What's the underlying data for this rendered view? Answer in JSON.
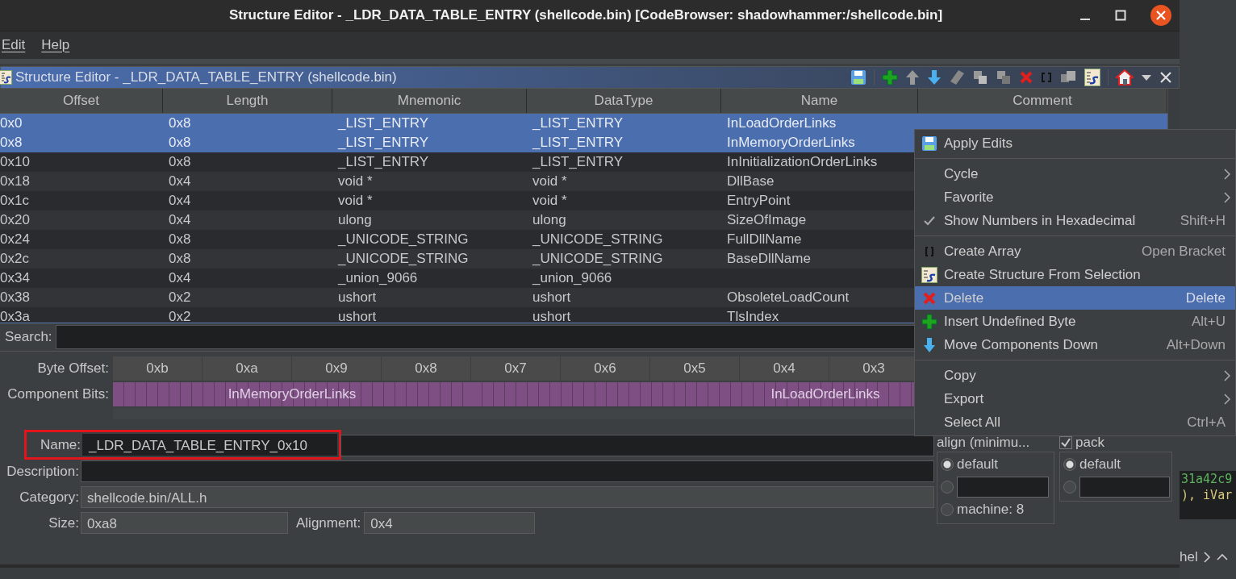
{
  "window": {
    "title": "Structure Editor - _LDR_DATA_TABLE_ENTRY (shellcode.bin) [CodeBrowser: shadowhammer:/shellcode.bin]"
  },
  "menubar": [
    {
      "label": "Edit"
    },
    {
      "label": "Help"
    }
  ],
  "panel": {
    "title": "Structure Editor - _LDR_DATA_TABLE_ENTRY (shellcode.bin)"
  },
  "table": {
    "columns": [
      "Offset",
      "Length",
      "Mnemonic",
      "DataType",
      "Name",
      "Comment"
    ],
    "rows": [
      {
        "cells": [
          "0x0",
          "0x8",
          "_LIST_ENTRY",
          "_LIST_ENTRY",
          "InLoadOrderLinks"
        ],
        "selected": true
      },
      {
        "cells": [
          "0x8",
          "0x8",
          "_LIST_ENTRY",
          "_LIST_ENTRY",
          "InMemoryOrderLinks"
        ],
        "selected": true
      },
      {
        "cells": [
          "0x10",
          "0x8",
          "_LIST_ENTRY",
          "_LIST_ENTRY",
          "InInitializationOrderLinks"
        ],
        "selected": false
      },
      {
        "cells": [
          "0x18",
          "0x4",
          "void *",
          "void *",
          "DllBase"
        ],
        "selected": false
      },
      {
        "cells": [
          "0x1c",
          "0x4",
          "void *",
          "void *",
          "EntryPoint"
        ],
        "selected": false
      },
      {
        "cells": [
          "0x20",
          "0x4",
          "ulong",
          "ulong",
          "SizeOfImage"
        ],
        "selected": false
      },
      {
        "cells": [
          "0x24",
          "0x8",
          "_UNICODE_STRING",
          "_UNICODE_STRING",
          "FullDllName"
        ],
        "selected": false
      },
      {
        "cells": [
          "0x2c",
          "0x8",
          "_UNICODE_STRING",
          "_UNICODE_STRING",
          "BaseDllName"
        ],
        "selected": false
      },
      {
        "cells": [
          "0x34",
          "0x4",
          "_union_9066",
          "_union_9066"
        ],
        "selected": false
      },
      {
        "cells": [
          "0x38",
          "0x2",
          "ushort",
          "ushort",
          "ObsoleteLoadCount"
        ],
        "selected": false
      },
      {
        "cells": [
          "0x3a",
          "0x2",
          "ushort",
          "ushort",
          "TlsIndex"
        ],
        "selected": false
      }
    ]
  },
  "search": {
    "label": "Search:"
  },
  "bytes": {
    "label": "Byte Offset:",
    "offsets": [
      "0xb",
      "0xa",
      "0x9",
      "0x8",
      "0x7",
      "0x6",
      "0x5",
      "0x4",
      "0x3"
    ],
    "bits_label": "Component Bits:",
    "components": [
      {
        "name": "InMemoryOrderLinks"
      },
      {
        "name": "InLoadOrderLinks"
      }
    ]
  },
  "form": {
    "fields": [
      {
        "label": "Name:",
        "value": "_LDR_DATA_TABLE_ENTRY_0x10",
        "highlighted": true
      },
      {
        "label": "Description:",
        "highlighted": false
      },
      {
        "label": "Category:",
        "value": "shellcode.bin/ALL.h",
        "highlighted": false
      }
    ],
    "size": {
      "label": "Size:",
      "value": "0xa8"
    },
    "alignment": {
      "label": "Alignment:",
      "value": "0x4"
    }
  },
  "align": {
    "title": "align (minimu...",
    "options": [
      {
        "kind": "radio",
        "label": "default",
        "selected": true
      },
      {
        "kind": "field",
        "selected": false
      },
      {
        "kind": "radio",
        "label": "machine: 8",
        "selected": false
      }
    ]
  },
  "pack": {
    "label": "pack",
    "checked": true,
    "options": [
      {
        "kind": "radio",
        "label": "default",
        "selected": true
      },
      {
        "kind": "field",
        "selected": false
      }
    ]
  },
  "context_menu": {
    "items": [
      {
        "kind": "item",
        "label": "Apply Edits",
        "selected": false
      },
      {
        "kind": "separator"
      },
      {
        "kind": "item",
        "label": "Cycle",
        "submenu": true,
        "selected": false
      },
      {
        "kind": "item",
        "label": "Favorite",
        "submenu": true,
        "selected": false
      },
      {
        "kind": "item",
        "label": "Show Numbers in Hexadecimal",
        "shortcut": "Shift+H",
        "checked": true,
        "selected": false
      },
      {
        "kind": "separator"
      },
      {
        "kind": "item",
        "label": "Create Array",
        "shortcut": "Open Bracket",
        "selected": false
      },
      {
        "kind": "item",
        "label": "Create Structure From Selection",
        "selected": false
      },
      {
        "kind": "item",
        "label": "Delete",
        "shortcut": "Delete",
        "selected": true
      },
      {
        "kind": "item",
        "label": "Insert Undefined Byte",
        "shortcut": "Alt+U",
        "selected": false
      },
      {
        "kind": "item",
        "label": "Move Components Down",
        "shortcut": "Alt+Down",
        "selected": false
      },
      {
        "kind": "separator"
      },
      {
        "kind": "item",
        "label": "Copy",
        "submenu": true,
        "selected": false
      },
      {
        "kind": "item",
        "label": "Export",
        "submenu": true,
        "selected": false
      },
      {
        "kind": "item",
        "label": "Select All",
        "shortcut": "Ctrl+A",
        "selected": false
      }
    ]
  },
  "background": {
    "code_lines": [
      "31a42c9",
      "), iVar"
    ],
    "breadcrumb": "hel"
  }
}
